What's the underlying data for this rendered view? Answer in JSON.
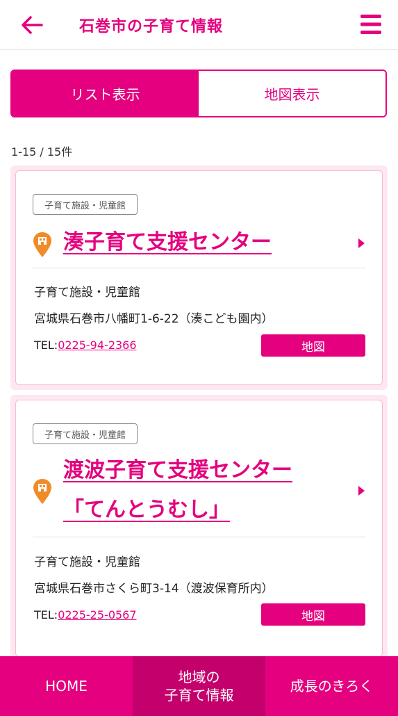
{
  "header": {
    "title": "石巻市の子育て情報",
    "back_icon": "arrow-left-icon",
    "menu_icon": "hamburger-menu-icon"
  },
  "toggle": {
    "list_label": "リスト表示",
    "map_label": "地図表示"
  },
  "result_count": "1-15 / 15件",
  "colors": {
    "accent": "#e4007f",
    "pin": "#f08c28"
  },
  "cards": [
    {
      "tag": "子育て施設・児童館",
      "name_line1": "湊子育て支援センター",
      "category": "子育て施設・児童館",
      "address": "宮城県石巻市八幡町1-6-22（湊こども園内）",
      "tel_label": "TEL:",
      "tel": "0225-94-2366",
      "map_label": "地図"
    },
    {
      "tag": "子育て施設・児童館",
      "name_line1": "渡波子育て支援センター",
      "name_line2": "「てんとうむし」",
      "category": "子育て施設・児童館",
      "address": "宮城県石巻市さくら町3-14（渡波保育所内）",
      "tel_label": "TEL:",
      "tel": "0225-25-0567",
      "map_label": "地図"
    }
  ],
  "bottom_nav": {
    "home": "HOME",
    "local_line1": "地域の",
    "local_line2": "子育て情報",
    "growth": "成長のきろく"
  }
}
